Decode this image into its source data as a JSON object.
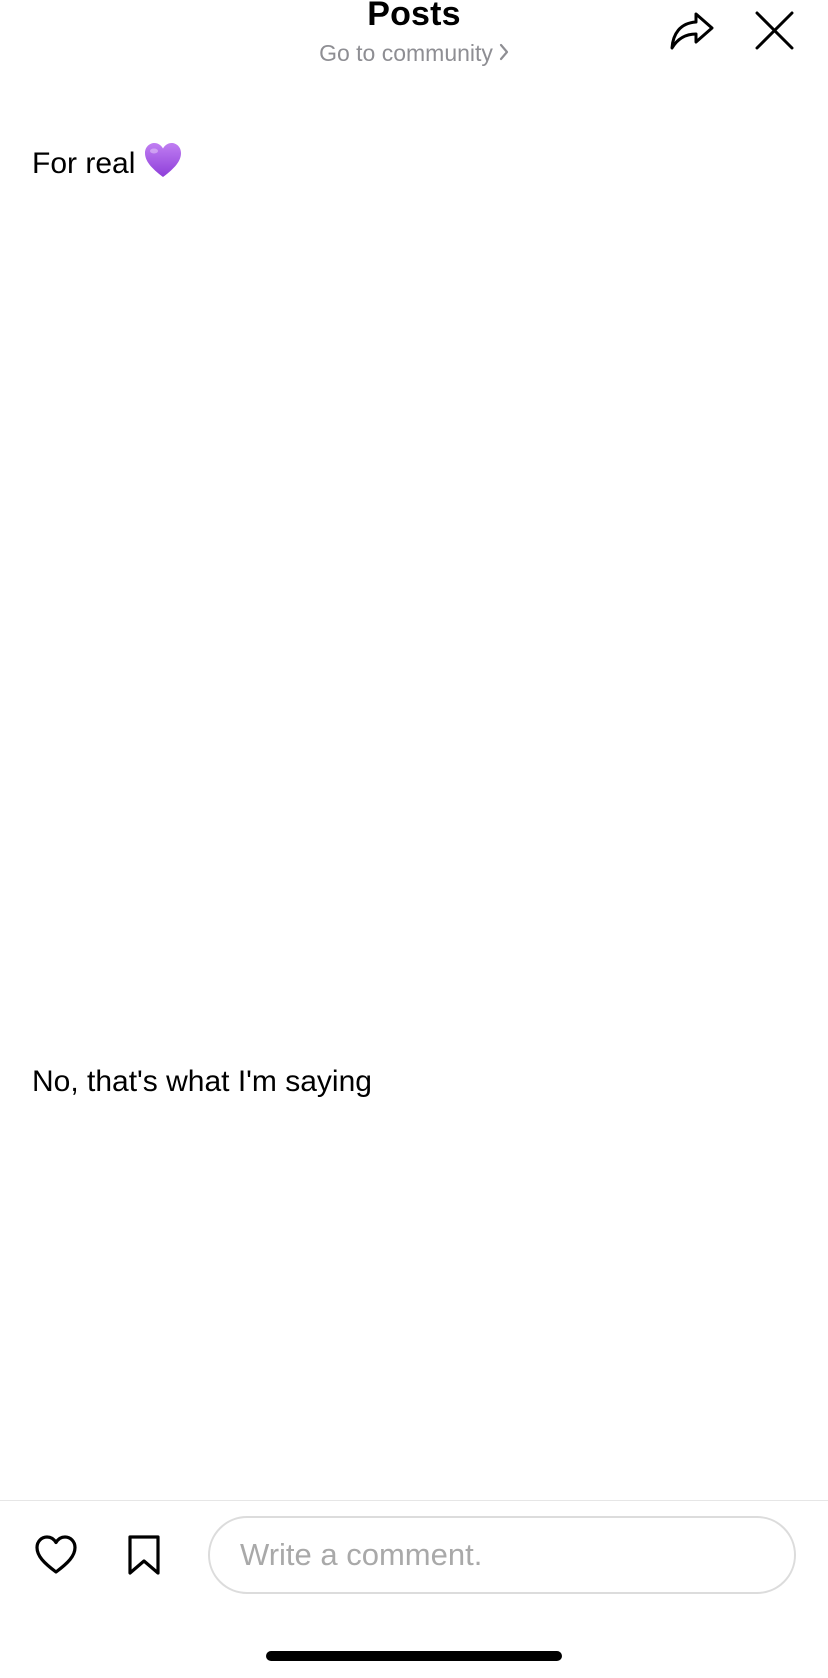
{
  "header": {
    "title": "Posts",
    "community_link": "Go to community",
    "share_icon": "share-arrow-icon",
    "close_icon": "close-icon"
  },
  "posts": [
    {
      "text": "For real",
      "emoji": "purple-heart-emoji",
      "emoji_color": "#a25ce6"
    },
    {
      "text": "No, that's what I'm saying"
    }
  ],
  "footer": {
    "like_icon": "heart-outline-icon",
    "bookmark_icon": "bookmark-outline-icon",
    "comment_placeholder": "Write a comment."
  },
  "colors": {
    "muted_text": "#8e8e93",
    "divider": "#e6e6e6",
    "input_border": "#dcdcdc",
    "placeholder": "#a9a9a9"
  }
}
